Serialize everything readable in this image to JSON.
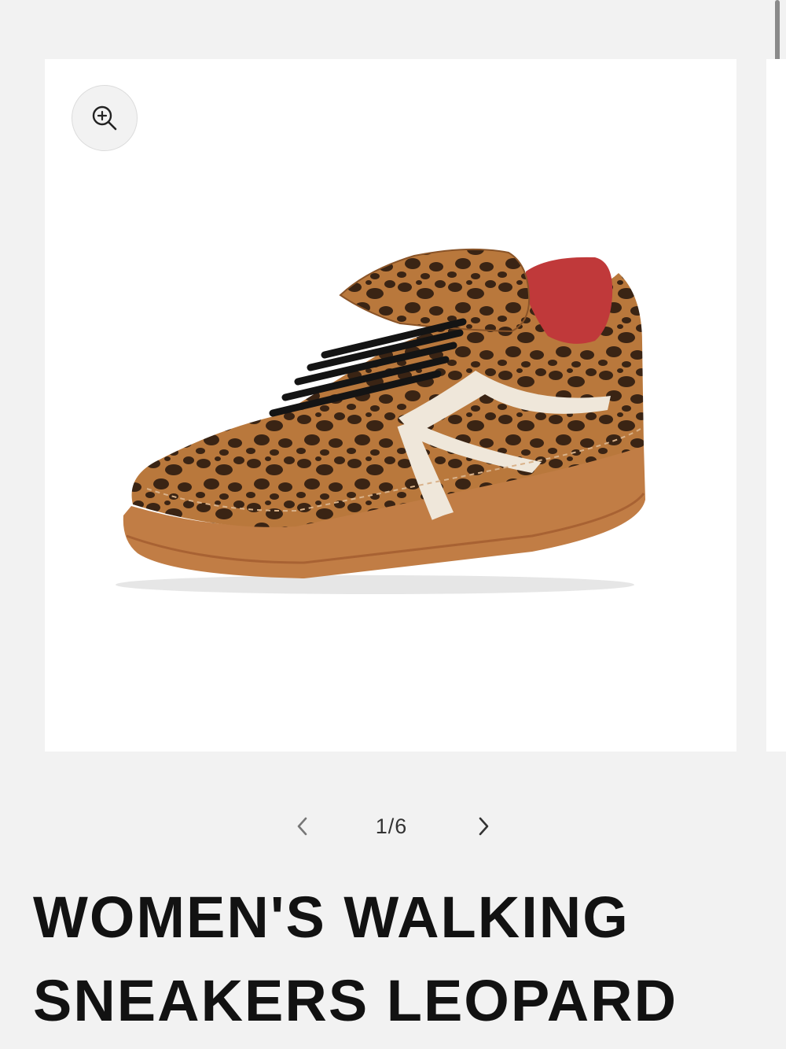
{
  "product": {
    "title": "WOMEN'S WALKING SNEAKERS LEOPARD",
    "image_alt": "Leopard print suede sneaker with white side stripes, black laces, red lining and gum sole"
  },
  "gallery": {
    "counter": "1/6",
    "current": 1,
    "total": 6,
    "zoom_icon": "zoom-in-icon",
    "prev_icon": "chevron-left-icon",
    "next_icon": "chevron-right-icon"
  },
  "colors": {
    "page_bg": "#f2f2f2",
    "card_bg": "#ffffff",
    "title_text": "#121212",
    "leopard_base": "#b9783c",
    "sole": "#c17d45",
    "lining": "#c0393a",
    "stripe": "#efe7da"
  }
}
